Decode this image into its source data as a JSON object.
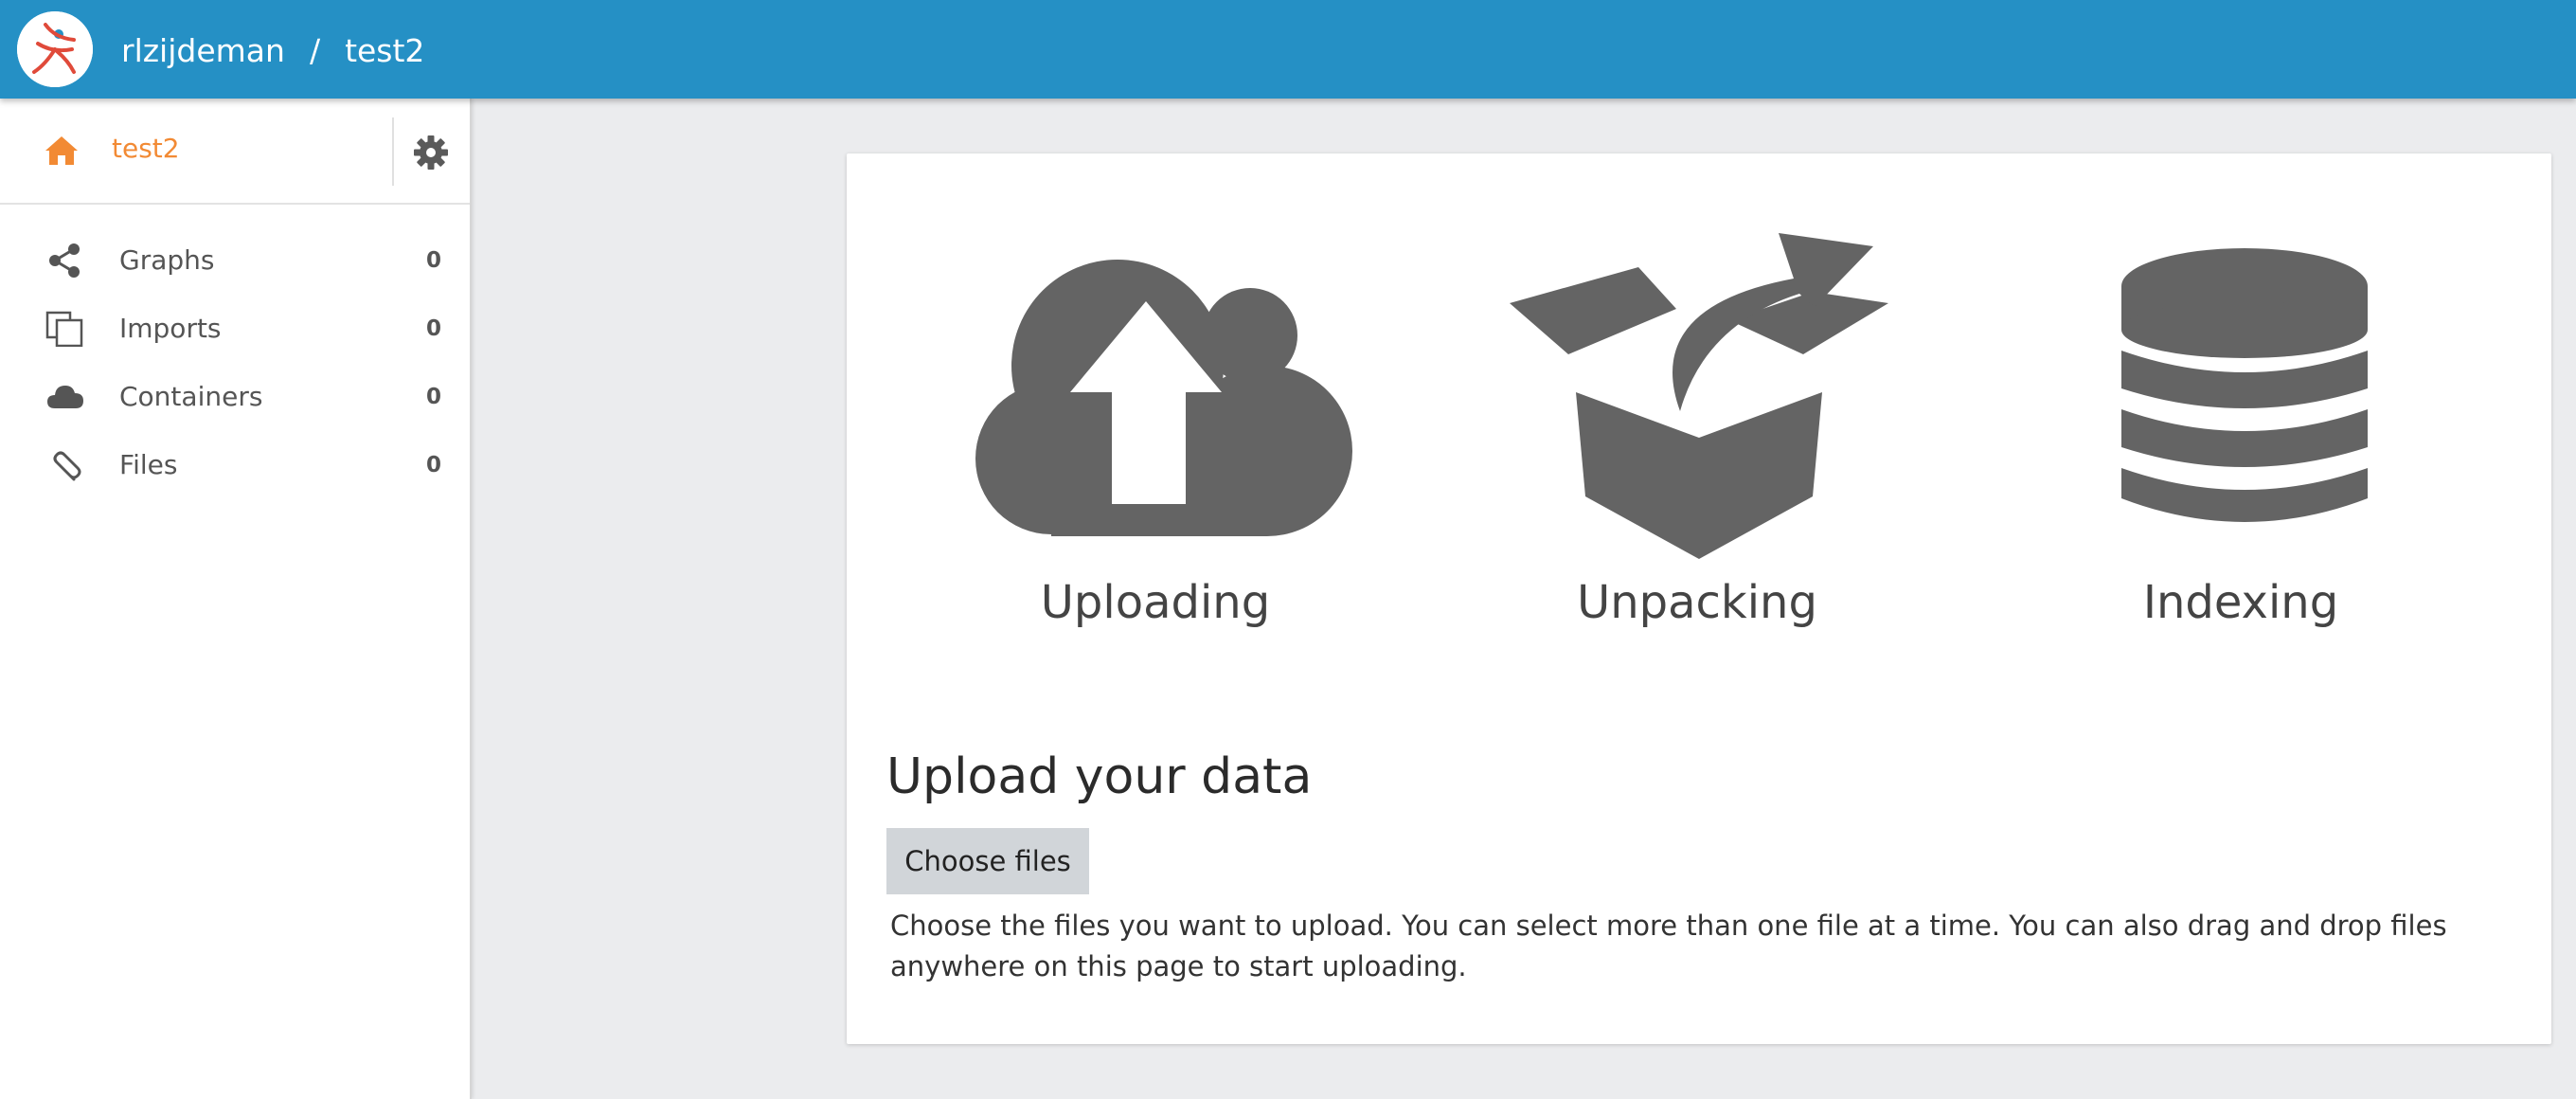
{
  "header": {
    "user": "rlzijdeman",
    "separator": "/",
    "dataset": "test2"
  },
  "sidebar": {
    "dataset_name": "test2",
    "items": [
      {
        "label": "Graphs",
        "count": "0",
        "icon": "share-icon"
      },
      {
        "label": "Imports",
        "count": "0",
        "icon": "copy-icon"
      },
      {
        "label": "Containers",
        "count": "0",
        "icon": "cloud-icon"
      },
      {
        "label": "Files",
        "count": "0",
        "icon": "paperclip-icon"
      }
    ]
  },
  "main": {
    "stages": [
      {
        "label": "Uploading",
        "icon": "cloud-upload-icon"
      },
      {
        "label": "Unpacking",
        "icon": "open-box-icon"
      },
      {
        "label": "Indexing",
        "icon": "database-icon"
      }
    ],
    "upload_title": "Upload your data",
    "choose_files_label": "Choose files",
    "upload_help": "Choose the files you want to upload. You can select more than one file at a time. You can also drag and drop files anywhere on this page to start uploading."
  },
  "colors": {
    "topbar": "#2590c5",
    "accent": "#f28a34",
    "icon_gray": "#646464",
    "background": "#ebecee"
  }
}
